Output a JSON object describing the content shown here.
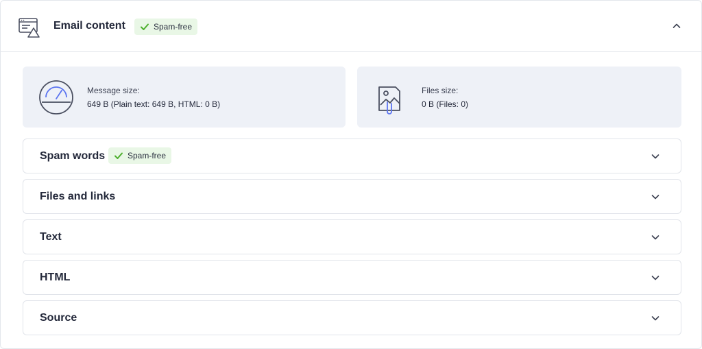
{
  "header": {
    "title": "Email content",
    "badge": "Spam-free",
    "icon": "email-alert-icon",
    "toggle_icon": "chevron-up-icon"
  },
  "cards": [
    {
      "icon": "speedometer-icon",
      "label": "Message size:",
      "value": "649 B (Plain text: 649 B, HTML: 0 B)"
    },
    {
      "icon": "image-attachment-icon",
      "label": "Files size:",
      "value": "0 B (Files: 0)"
    }
  ],
  "sections": [
    {
      "title": "Spam words",
      "badge": "Spam-free"
    },
    {
      "title": "Files and links"
    },
    {
      "title": "Text"
    },
    {
      "title": "HTML"
    },
    {
      "title": "Source"
    }
  ],
  "colors": {
    "badge_bg": "#e9f7e6",
    "check": "#4caf2c",
    "card_bg": "#eef1f7",
    "accent_blue": "#5b74f0"
  }
}
